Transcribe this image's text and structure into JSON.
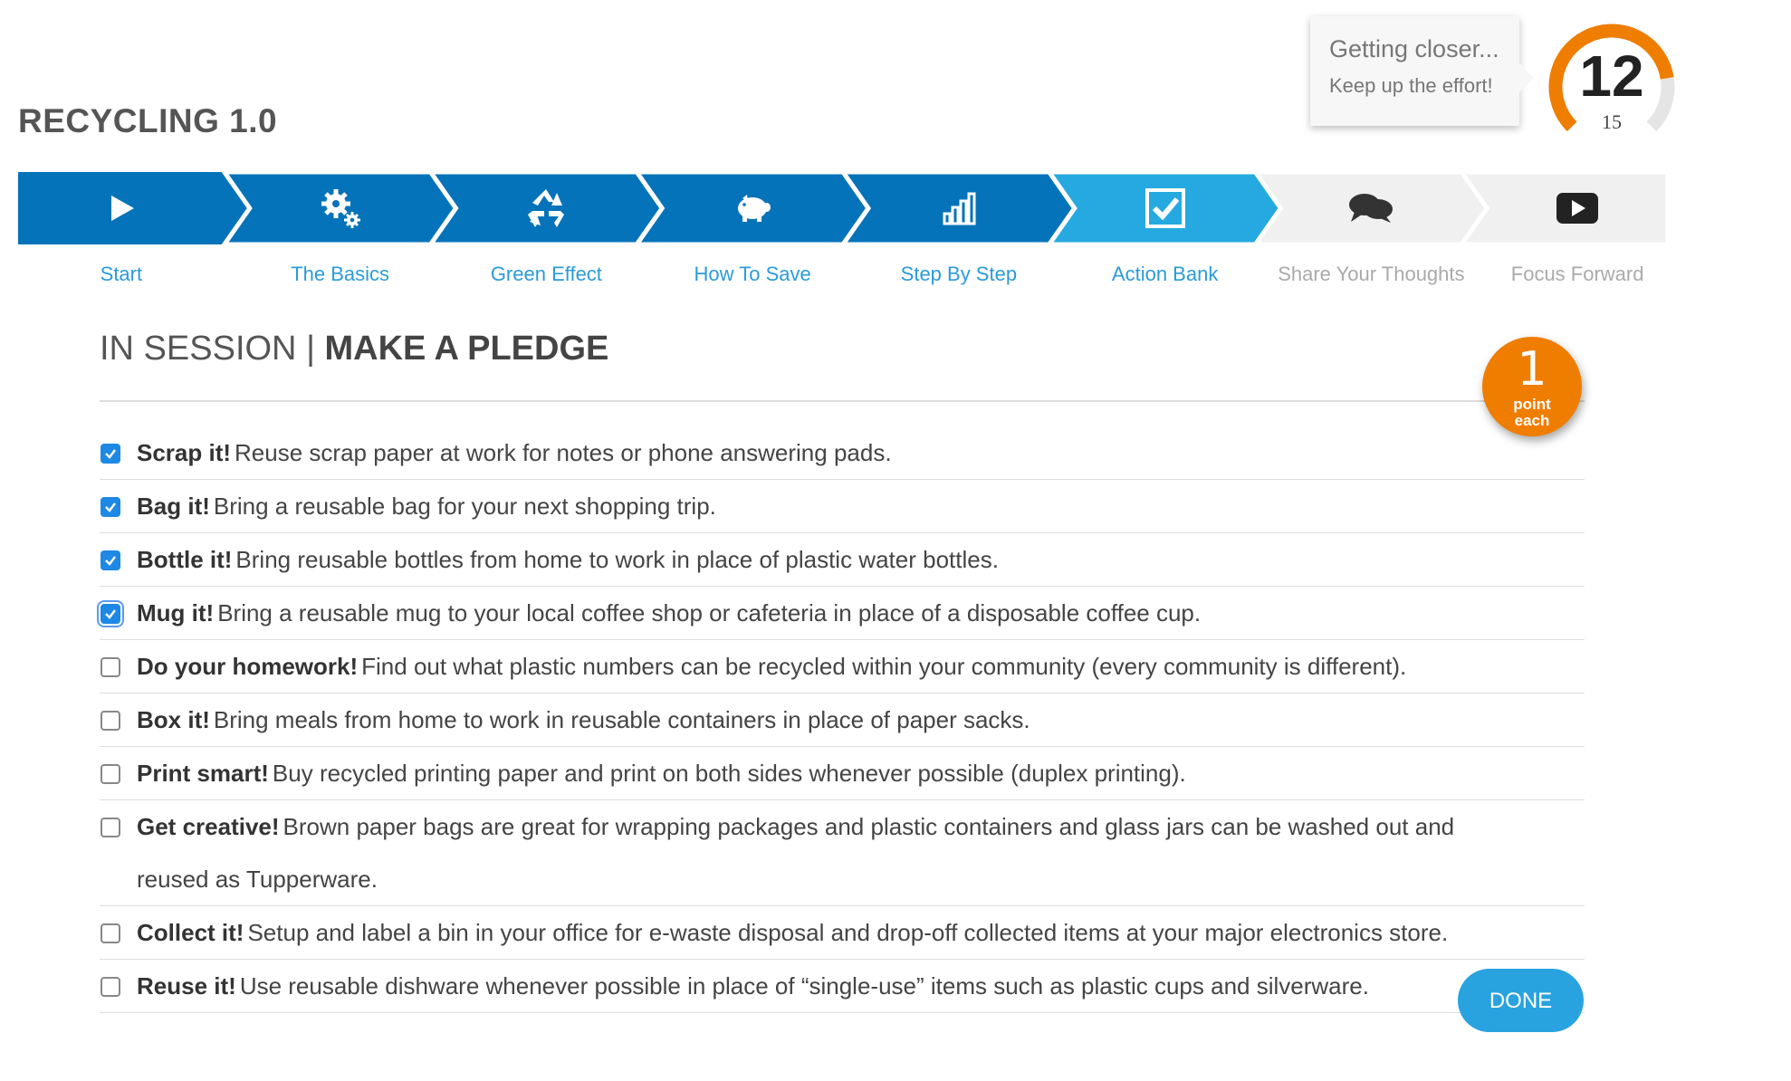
{
  "app": {
    "title": "RECYCLING 1.0"
  },
  "progress": {
    "tooltip_title": "Getting closer...",
    "tooltip_subtitle": "Keep up the effort!",
    "score": "12",
    "max": "15",
    "score_fraction": 0.8,
    "accent": "#ef7d00",
    "track": "#e5e5e5"
  },
  "steps": [
    {
      "label": "Start",
      "icon": "play-icon",
      "state": "done"
    },
    {
      "label": "The Basics",
      "icon": "gears-icon",
      "state": "done"
    },
    {
      "label": "Green Effect",
      "icon": "recycle-icon",
      "state": "done"
    },
    {
      "label": "How To Save",
      "icon": "piggy-bank-icon",
      "state": "done"
    },
    {
      "label": "Step By Step",
      "icon": "bar-chart-icon",
      "state": "done"
    },
    {
      "label": "Action Bank",
      "icon": "checkbox-icon",
      "state": "current"
    },
    {
      "label": "Share Your Thoughts",
      "icon": "chat-bubbles-icon",
      "state": "todo"
    },
    {
      "label": "Focus Forward",
      "icon": "video-play-icon",
      "state": "todo"
    }
  ],
  "colors": {
    "done": "#0573b9",
    "current": "#26a9e0",
    "todo": "#f0f0f0",
    "todo_text": "#aaaaaa",
    "done_text": "#2b9bd8"
  },
  "session": {
    "prefix": "IN SESSION",
    "separator": "|",
    "title": "MAKE A PLEDGE",
    "badge_value": "1",
    "badge_unit": "point each"
  },
  "pledges": [
    {
      "title": "Scrap it!",
      "text": "Reuse scrap paper at work for notes or phone answering pads.",
      "checked": true
    },
    {
      "title": "Bag it!",
      "text": "Bring a reusable bag for your next shopping trip.",
      "checked": true
    },
    {
      "title": "Bottle it!",
      "text": "Bring reusable bottles from home to work in place of plastic water bottles.",
      "checked": true
    },
    {
      "title": "Mug it!",
      "text": "Bring a reusable mug to your local coffee shop or cafeteria in place of a disposable coffee cup.",
      "checked": true,
      "focused": true
    },
    {
      "title": "Do your homework!",
      "text": "Find out what plastic numbers can be recycled within your community (every community is different).",
      "checked": false
    },
    {
      "title": "Box it!",
      "text": "Bring meals from home to work in reusable containers in place of paper sacks.",
      "checked": false
    },
    {
      "title": "Print smart!",
      "text": "Buy recycled printing paper and print on both sides whenever possible (duplex printing).",
      "checked": false
    },
    {
      "title": "Get creative!",
      "text": "Brown paper bags are great for wrapping packages and plastic containers and glass jars can be washed out and reused as Tupperware.",
      "checked": false
    },
    {
      "title": "Collect it!",
      "text": "Setup and label a bin in your office for e-waste disposal and drop-off collected items at your major electronics store.",
      "checked": false
    },
    {
      "title": "Reuse it!",
      "text": "Use reusable dishware whenever possible in place of “single-use” items such as plastic cups and silverware.",
      "checked": false
    }
  ],
  "actions": {
    "done_label": "DONE"
  }
}
